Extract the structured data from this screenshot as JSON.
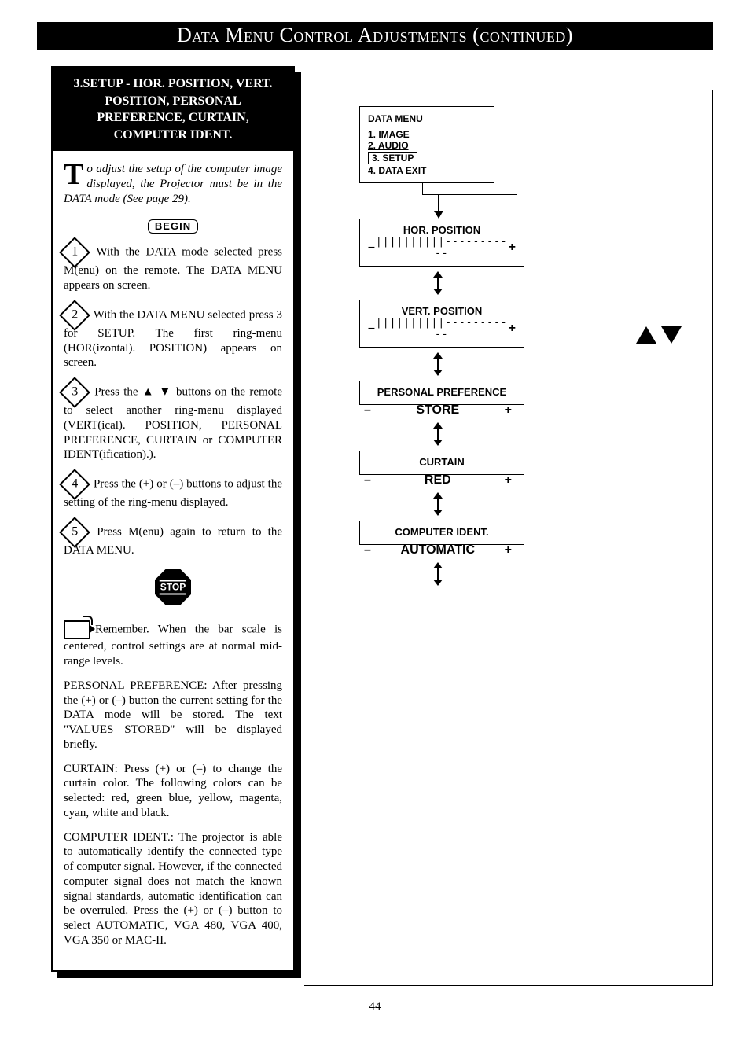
{
  "title": "Data Menu Control Adjustments (continued)",
  "page_number": "44",
  "subtitle": "3.SETUP - HOR. POSITION, VERT. POSITION, PERSONAL PREFERENCE, CURTAIN, COMPUTER IDENT.",
  "intro_first_char": "T",
  "intro_rest": "o adjust the setup of the computer image displayed, the Projector must be in the DATA mode (See page 29).",
  "begin_label": "BEGIN",
  "stop_label": "STOP",
  "steps": [
    "With the DATA mode selected press M(enu) on the remote. The DATA MENU appears on screen.",
    "With the DATA MENU selected press 3 for SETUP. The first ring-menu (HOR(izontal). POSITION) appears on screen.",
    "Press the ▲ ▼ buttons on the remote to select another ring-menu displayed (VERT(ical). POSITION, PERSONAL PREFERENCE, CURTAIN or COMPUTER IDENT(ification).).",
    "Press the (+) or (–) buttons to adjust the setting of the ring-menu displayed.",
    "Press M(enu) again to return to the DATA MENU."
  ],
  "notes": [
    "Remember. When the bar scale is centered, control settings are at normal mid-range levels.",
    "PERSONAL PREFERENCE: After pressing the (+) or (–) button the current setting for the DATA mode will be stored. The text \"VALUES STORED\" will be displayed briefly.",
    "CURTAIN: Press (+) or (–) to change the curtain color. The following colors can be selected: red, green blue, yellow, magenta, cyan, white and black.",
    "COMPUTER IDENT.: The projector is able to automatically identify the connected type of computer signal. However, if the connected computer signal does not match the known signal standards, automatic identification can be overruled. Press the (+) or (–) button to select AUTOMATIC, VGA 480, VGA 400, VGA 350 or MAC-II."
  ],
  "menu": {
    "header": "DATA MENU",
    "items": [
      "1. IMAGE",
      "2. AUDIO",
      "3. SETUP",
      "4. DATA EXIT"
    ],
    "selected_index": 2
  },
  "rings": [
    {
      "title": "HOR. POSITION",
      "type": "bar",
      "value": "||||||||||-----------"
    },
    {
      "title": "VERT. POSITION",
      "type": "bar",
      "value": "||||||||||-----------"
    },
    {
      "title": "PERSONAL PREFERENCE",
      "type": "text",
      "value": "STORE"
    },
    {
      "title": "CURTAIN",
      "type": "text",
      "value": "RED"
    },
    {
      "title": "COMPUTER IDENT.",
      "type": "text",
      "value": "AUTOMATIC"
    }
  ],
  "pm": {
    "minus": "–",
    "plus": "+"
  }
}
